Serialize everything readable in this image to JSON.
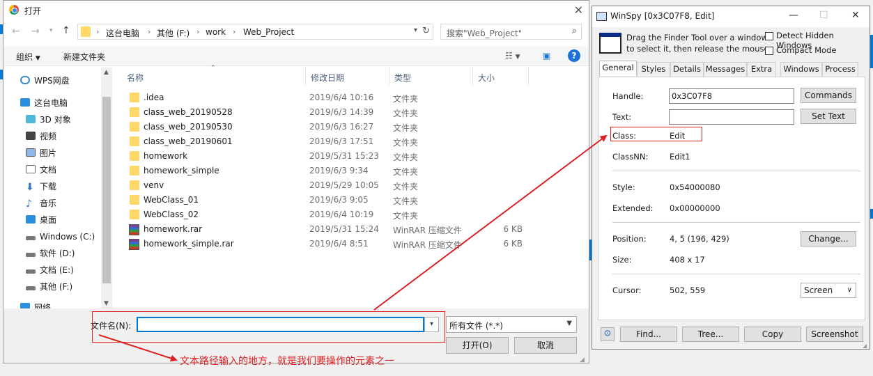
{
  "dialog": {
    "title": "打开",
    "breadcrumb": [
      "这台电脑",
      "其他 (F:)",
      "work",
      "Web_Project"
    ],
    "search_placeholder": "搜索\"Web_Project\"",
    "toolbar": {
      "organize": "组织",
      "new_folder": "新建文件夹",
      "help": "?"
    },
    "tree": [
      "WPS网盘",
      "这台电脑",
      "3D 对象",
      "视频",
      "图片",
      "文档",
      "下载",
      "音乐",
      "桌面",
      "Windows (C:)",
      "软件 (D:)",
      "文档 (E:)",
      "其他 (F:)",
      "网络"
    ],
    "columns": {
      "name": "名称",
      "date": "修改日期",
      "type": "类型",
      "size": "大小"
    },
    "files": [
      {
        "name": ".idea",
        "date": "2019/6/4 10:16",
        "type": "文件夹",
        "size": "",
        "kind": "folder"
      },
      {
        "name": "class_web_20190528",
        "date": "2019/6/3 14:39",
        "type": "文件夹",
        "size": "",
        "kind": "folder"
      },
      {
        "name": "class_web_20190530",
        "date": "2019/6/3 16:27",
        "type": "文件夹",
        "size": "",
        "kind": "folder"
      },
      {
        "name": "class_web_20190601",
        "date": "2019/6/3 17:51",
        "type": "文件夹",
        "size": "",
        "kind": "folder"
      },
      {
        "name": "homework",
        "date": "2019/5/31 15:23",
        "type": "文件夹",
        "size": "",
        "kind": "folder"
      },
      {
        "name": "homework_simple",
        "date": "2019/6/3 9:34",
        "type": "文件夹",
        "size": "",
        "kind": "folder"
      },
      {
        "name": "venv",
        "date": "2019/5/29 10:05",
        "type": "文件夹",
        "size": "",
        "kind": "folder"
      },
      {
        "name": "WebClass_01",
        "date": "2019/6/3 9:05",
        "type": "文件夹",
        "size": "",
        "kind": "folder"
      },
      {
        "name": "WebClass_02",
        "date": "2019/6/4 10:19",
        "type": "文件夹",
        "size": "",
        "kind": "folder"
      },
      {
        "name": "homework.rar",
        "date": "2019/5/31 15:24",
        "type": "WinRAR 压缩文件",
        "size": "6 KB",
        "kind": "rar"
      },
      {
        "name": "homework_simple.rar",
        "date": "2019/6/4 8:51",
        "type": "WinRAR 压缩文件",
        "size": "6 KB",
        "kind": "rar"
      }
    ],
    "filename_label": "文件名(N):",
    "filename_value": "",
    "filter_value": "所有文件 (*.*)",
    "open_button": "打开(O)",
    "cancel_button": "取消"
  },
  "winspy": {
    "title": "WinSpy [0x3C07F8, Edit]",
    "desc_line1": "Drag the Finder Tool over a window",
    "desc_line2": "to select it, then release the mouse",
    "detect_hidden": "Detect Hidden Windows",
    "compact_mode": "Compact Mode",
    "tabs": [
      "General",
      "Styles",
      "Details",
      "Messages",
      "Extra",
      "Windows",
      "Process"
    ],
    "handle_label": "Handle:",
    "handle_value": "0x3C07F8",
    "text_label": "Text:",
    "text_value": "",
    "commands_button": "Commands",
    "settext_button": "Set Text",
    "class_label": "Class:",
    "class_value": "Edit",
    "classnn_label": "ClassNN:",
    "classnn_value": "Edit1",
    "style_label": "Style:",
    "style_value": "0x54000080",
    "extended_label": "Extended:",
    "extended_value": "0x00000000",
    "position_label": "Position:",
    "position_value": "4, 5 (196, 429)",
    "size_label": "Size:",
    "size_value": "408 x 17",
    "cursor_label": "Cursor:",
    "cursor_value": "502, 559",
    "change_button": "Change...",
    "screen_select": "Screen",
    "buttons": {
      "find": "Find...",
      "tree": "Tree...",
      "copy": "Copy",
      "screenshot": "Screenshot"
    }
  },
  "annotation": "文本路径输入的地方，就是我们要操作的元素之一",
  "colors": {
    "accent": "#0078d7",
    "annotation": "#e02020",
    "folder": "#ffd869"
  }
}
